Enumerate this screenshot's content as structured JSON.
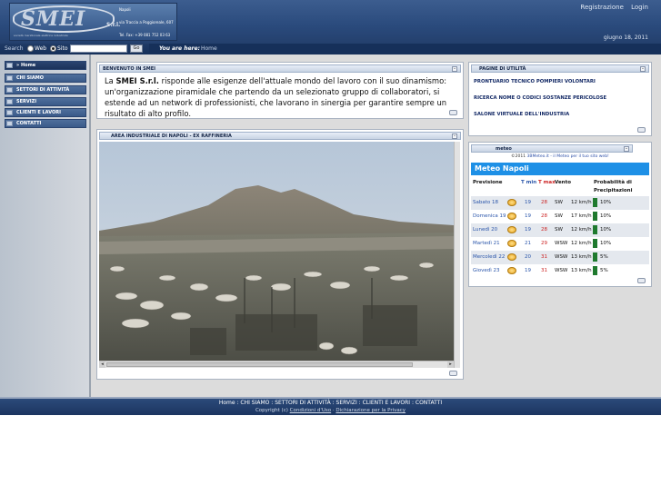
{
  "header": {
    "logo_text": "SMEI",
    "logo_suffix": "S.r.l.",
    "logo_tagline": "società meridionale elettrica industriale",
    "address": [
      "Napoli",
      "via Traccia a Poggioreale, 607",
      "Tel. Fax: +39 081 752 03 63"
    ],
    "links": [
      "Registrazione",
      "Login"
    ],
    "date": "giugno 18, 2011"
  },
  "search": {
    "label": "Search",
    "options": [
      "Web",
      "Sito"
    ],
    "selected": "Sito",
    "value": "",
    "go_label": "Go",
    "you_are_here_label": "You are here:",
    "breadcrumb": "Home"
  },
  "sidebar": {
    "items": [
      {
        "label": "» Home",
        "active": true
      },
      {
        "label": "CHI SIAMO",
        "active": false
      },
      {
        "label": "SETTORI DI ATTIVITÀ",
        "active": false
      },
      {
        "label": "SERVIZI",
        "active": false
      },
      {
        "label": "CLIENTI E LAVORI",
        "active": false
      },
      {
        "label": "CONTATTI",
        "active": false
      }
    ]
  },
  "welcome": {
    "title": "BENVENUTO IN SMEI",
    "text_pre": "La ",
    "text_bold": "SMEI S.r.l.",
    "text_post": " risponde alle esigenze dell'attuale mondo del lavoro con il suo dinamismo: un'organizzazione piramidale che partendo da un selezionato gruppo di collaboratori, si estende ad un network di professionisti, che lavorano in sinergia per garantire sempre un risultato di alto profilo."
  },
  "area": {
    "title": "AREA INDUSTRIALE DI NAPOLI - EX RAFFINERIA"
  },
  "utility": {
    "title": "PAGINE DI UTILITÀ",
    "links": [
      "PRONTUARIO TECNICO POMPIERI VOLONTARI",
      "RICERCA NOME O CODICI SOSTANZE PERICOLOSE",
      "SALONE VIRTUALE DELL'INDUSTRIA"
    ]
  },
  "meteo": {
    "title": "meteo",
    "credit_pre": "©2011 ",
    "credit_link": "3BMeteo.it - il Meteo per il tuo sito web!",
    "city": "Meteo Napoli",
    "headers": {
      "forecast": "Previsione",
      "tmin": "T min",
      "tmax": "T max",
      "wind": "Vento",
      "prob": "Probabilità di Precipitazioni"
    },
    "rows": [
      {
        "day": "Sabato 18",
        "tmin": "19",
        "tmax": "28",
        "dir": "SW",
        "speed": "12 km/h",
        "prob": "10%"
      },
      {
        "day": "Domenica 19",
        "tmin": "19",
        "tmax": "28",
        "dir": "SW",
        "speed": "17 km/h",
        "prob": "10%"
      },
      {
        "day": "Lunedì 20",
        "tmin": "19",
        "tmax": "28",
        "dir": "SW",
        "speed": "12 km/h",
        "prob": "10%"
      },
      {
        "day": "Martedì 21",
        "tmin": "21",
        "tmax": "29",
        "dir": "WSW",
        "speed": "12 km/h",
        "prob": "10%"
      },
      {
        "day": "Mercoledì 22",
        "tmin": "20",
        "tmax": "31",
        "dir": "WSW",
        "speed": "13 km/h",
        "prob": "5%"
      },
      {
        "day": "Giovedì 23",
        "tmin": "19",
        "tmax": "31",
        "dir": "WSW",
        "speed": "13 km/h",
        "prob": "5%"
      }
    ]
  },
  "footer": {
    "nav": "Home : CHI SIAMO : SETTORI DI ATTIVITÀ : SERVIZI : CLIENTI E LAVORI : CONTATTI",
    "copyright": "Copyright (c)",
    "conditions": "Condizioni d'Uso",
    "privacy": "Dichiarazione per la Privacy"
  }
}
